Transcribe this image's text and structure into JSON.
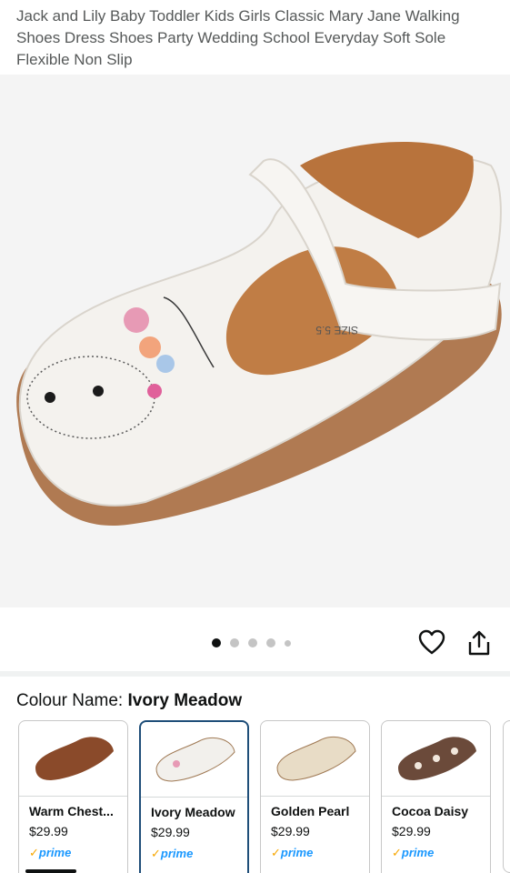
{
  "product": {
    "title": "Jack and Lily Baby Toddler Kids Girls Classic Mary Jane Walking Shoes Dress Shoes Party Wedding School Everyday Soft Sole Flexible Non Slip"
  },
  "gallery": {
    "image_count": 5,
    "active_index": 0
  },
  "actions": {
    "favorite_icon": "heart-icon",
    "share_icon": "share-icon"
  },
  "colour": {
    "label": "Colour Name: ",
    "selected": "Ivory Meadow"
  },
  "swatches": [
    {
      "name": "Warm Chest...",
      "price": "$29.99",
      "prime": "prime",
      "color": "#8a4a2a"
    },
    {
      "name": "Ivory Meadow",
      "price": "$29.99",
      "prime": "prime",
      "color": "#f2f0ec"
    },
    {
      "name": "Golden Pearl",
      "price": "$29.99",
      "prime": "prime",
      "color": "#e8dcc6"
    },
    {
      "name": "Cocoa Daisy",
      "price": "$29.99",
      "prime": "prime",
      "color": "#6b4a3a"
    }
  ],
  "colors": {
    "selected_border": "#1f4e79",
    "prime_blue": "#1a98ff",
    "prime_check": "#f7a600"
  }
}
